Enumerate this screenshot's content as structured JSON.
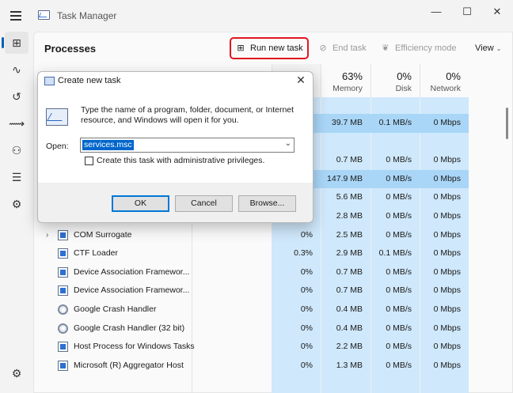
{
  "window": {
    "title": "Task Manager",
    "controls": {
      "minimize": "—",
      "maximize": "☐",
      "close": "✕"
    }
  },
  "nav": {
    "items": [
      {
        "name": "processes",
        "glyph": "⊞",
        "active": true
      },
      {
        "name": "performance",
        "glyph": "∿",
        "active": false
      },
      {
        "name": "app-history",
        "glyph": "↺",
        "active": false
      },
      {
        "name": "startup-apps",
        "glyph": "⟿",
        "active": false
      },
      {
        "name": "users",
        "glyph": "⚇",
        "active": false
      },
      {
        "name": "details",
        "glyph": "☰",
        "active": false
      },
      {
        "name": "services",
        "glyph": "⚙",
        "active": false
      }
    ],
    "settings_glyph": "⚙"
  },
  "toolbar": {
    "page_title": "Processes",
    "run_new_task": "Run new task",
    "end_task": "End task",
    "efficiency_mode": "Efficiency mode",
    "view": "View"
  },
  "columns": {
    "cpu": {
      "pct": "",
      "label": ""
    },
    "memory": {
      "pct": "63%",
      "label": "Memory"
    },
    "disk": {
      "pct": "0%",
      "label": "Disk"
    },
    "network": {
      "pct": "0%",
      "label": "Network"
    }
  },
  "partial_header": {
    "pct": "6",
    "label": "U"
  },
  "rows": [
    {
      "name": "",
      "cpu": "%",
      "memory": "39.7 MB",
      "disk": "0.1 MB/s",
      "network": "0 Mbps",
      "icon": "none",
      "expand": false
    },
    {
      "name": "",
      "cpu": "",
      "memory": "",
      "disk": "",
      "network": "",
      "icon": "none",
      "expand": false
    },
    {
      "name": "",
      "cpu": "%",
      "memory": "0.7 MB",
      "disk": "0 MB/s",
      "network": "0 Mbps",
      "icon": "none",
      "expand": false
    },
    {
      "name": "",
      "cpu": "%",
      "memory": "147.9 MB",
      "disk": "0 MB/s",
      "network": "0 Mbps",
      "icon": "none",
      "expand": false
    },
    {
      "name": "",
      "cpu": "%",
      "memory": "5.6 MB",
      "disk": "0 MB/s",
      "network": "0 Mbps",
      "icon": "none",
      "expand": false
    },
    {
      "name": "COM Surrogate",
      "cpu": "0%",
      "memory": "2.8 MB",
      "disk": "0 MB/s",
      "network": "0 Mbps",
      "icon": "window",
      "expand": false
    },
    {
      "name": "COM Surrogate",
      "cpu": "0%",
      "memory": "2.5 MB",
      "disk": "0 MB/s",
      "network": "0 Mbps",
      "icon": "window",
      "expand": true
    },
    {
      "name": "CTF Loader",
      "cpu": "0.3%",
      "memory": "2.9 MB",
      "disk": "0.1 MB/s",
      "network": "0 Mbps",
      "icon": "window",
      "expand": false
    },
    {
      "name": "Device Association Framewor...",
      "cpu": "0%",
      "memory": "0.7 MB",
      "disk": "0 MB/s",
      "network": "0 Mbps",
      "icon": "window",
      "expand": false
    },
    {
      "name": "Device Association Framewor...",
      "cpu": "0%",
      "memory": "0.7 MB",
      "disk": "0 MB/s",
      "network": "0 Mbps",
      "icon": "window",
      "expand": false
    },
    {
      "name": "Google Crash Handler",
      "cpu": "0%",
      "memory": "0.4 MB",
      "disk": "0 MB/s",
      "network": "0 Mbps",
      "icon": "gear",
      "expand": false
    },
    {
      "name": "Google Crash Handler (32 bit)",
      "cpu": "0%",
      "memory": "0.4 MB",
      "disk": "0 MB/s",
      "network": "0 Mbps",
      "icon": "gear",
      "expand": false
    },
    {
      "name": "Host Process for Windows Tasks",
      "cpu": "0%",
      "memory": "2.2 MB",
      "disk": "0 MB/s",
      "network": "0 Mbps",
      "icon": "window",
      "expand": false
    },
    {
      "name": "Microsoft (R) Aggregator Host",
      "cpu": "0%",
      "memory": "1.3 MB",
      "disk": "0 MB/s",
      "network": "0 Mbps",
      "icon": "window",
      "expand": false
    }
  ],
  "dialog": {
    "title": "Create new task",
    "close": "✕",
    "description": "Type the name of a program, folder, document, or Internet resource, and Windows will open it for you.",
    "open_label": "Open:",
    "open_value": "services.msc",
    "admin_label": "Create this task with administrative privileges.",
    "admin_checked": false,
    "ok": "OK",
    "cancel": "Cancel",
    "browse": "Browse..."
  },
  "colors": {
    "accent": "#005fb8",
    "highlight_row": "#cce8ff",
    "cell_fill": "#bfe0f7",
    "run_border": "#e0161d"
  }
}
